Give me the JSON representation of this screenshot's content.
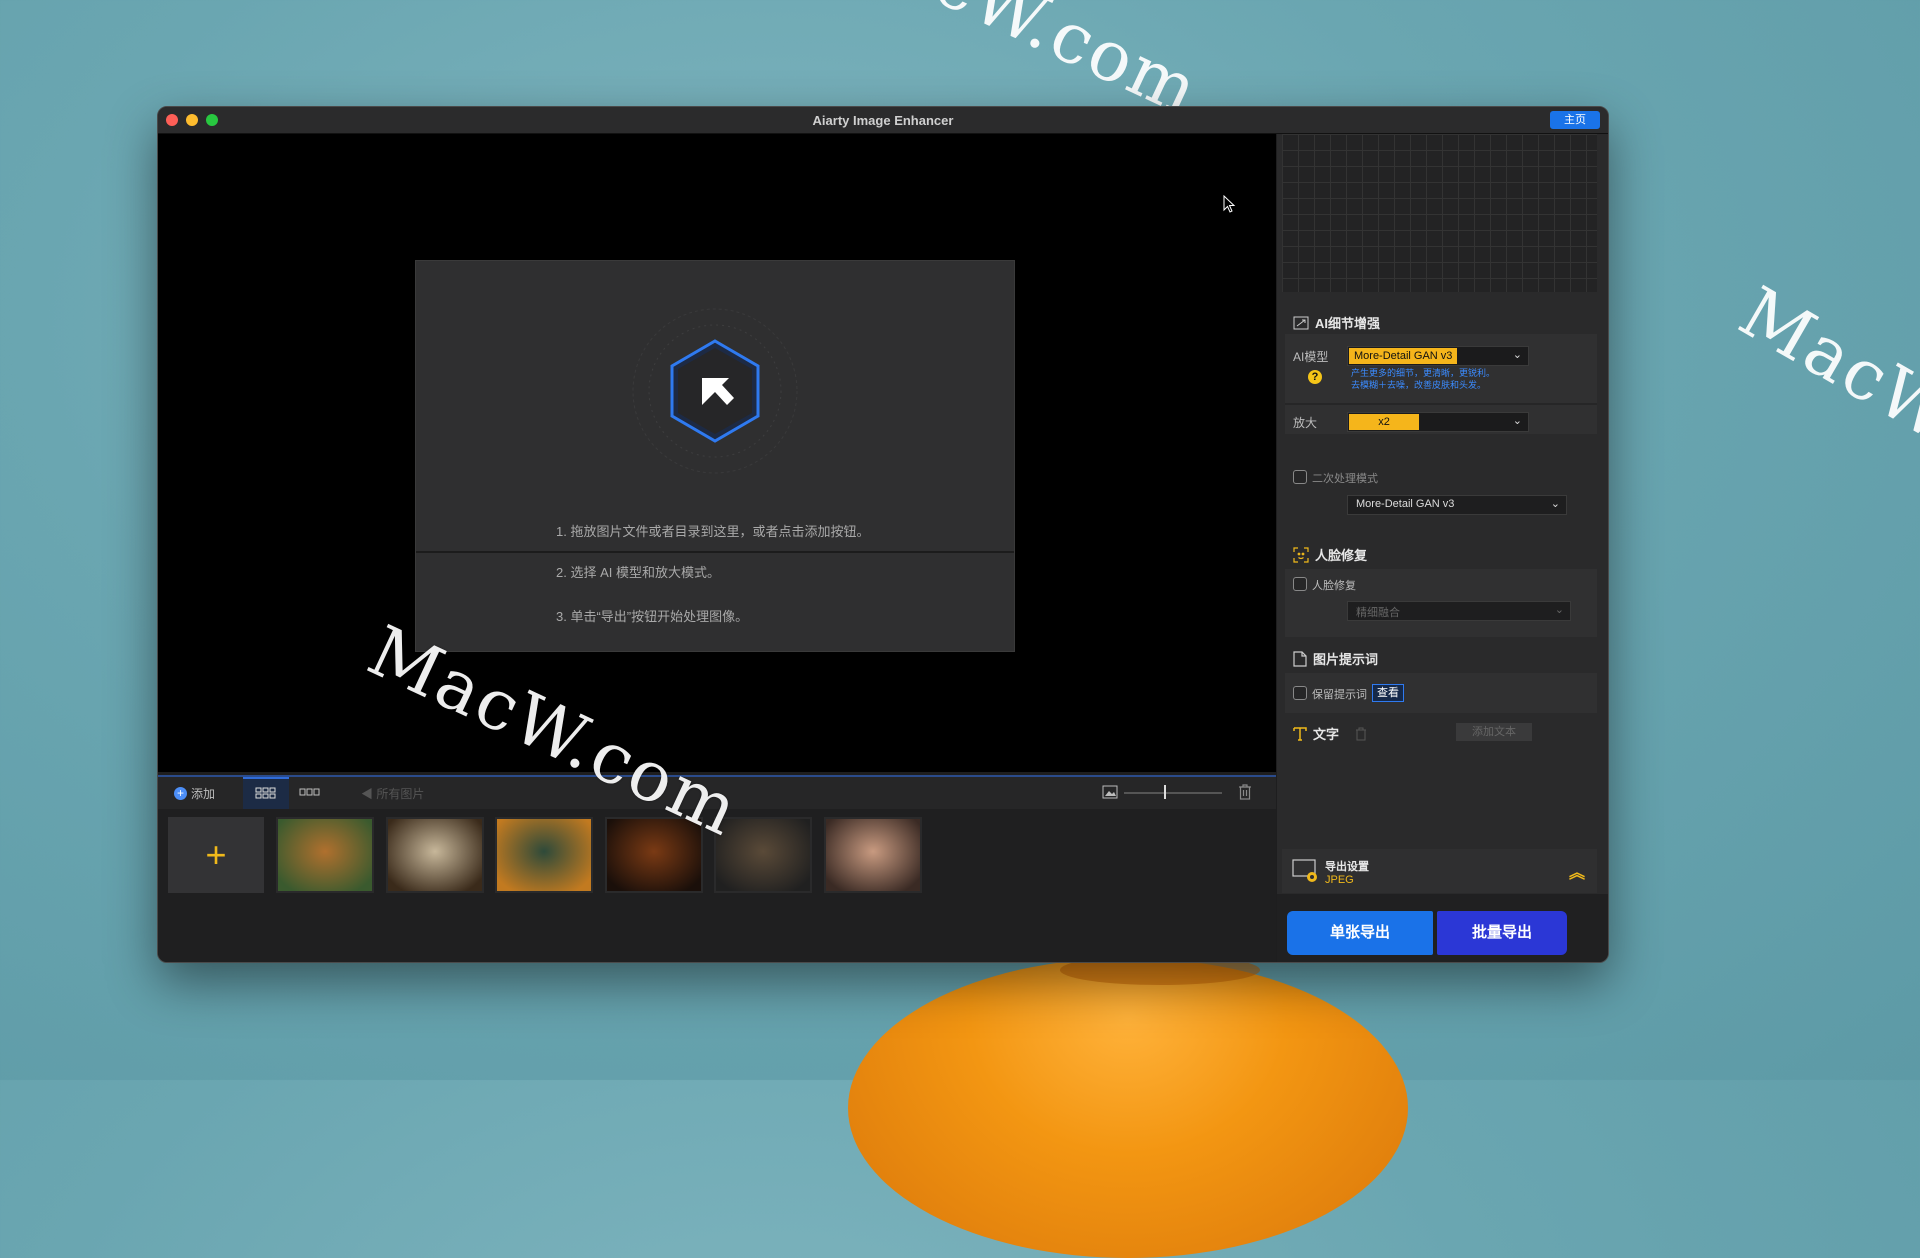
{
  "window": {
    "title": "Aiarty Image Enhancer",
    "home_label": "主页"
  },
  "watermark": "MacW.com",
  "drop_zone": {
    "step1": "1. 拖放图片文件或者目录到这里，或者点击添加按钮。",
    "step2": "2. 选择 AI 模型和放大模式。",
    "step3": "3. 单击“导出”按钮开始处理图像。"
  },
  "toolbar": {
    "add_label": "添加",
    "all_images_label": "所有图片"
  },
  "thumbnails": [
    {
      "name": "tiger",
      "colors": [
        "#b0702e",
        "#3a5a2e"
      ]
    },
    {
      "name": "butterfly",
      "colors": [
        "#c7b79a",
        "#3a2a1a"
      ]
    },
    {
      "name": "bottle-garden",
      "colors": [
        "#2e4a3a",
        "#c27a20"
      ]
    },
    {
      "name": "burger",
      "colors": [
        "#7a3a14",
        "#1a0f0a"
      ]
    },
    {
      "name": "dog-warrior",
      "colors": [
        "#5a4a38",
        "#202020"
      ]
    },
    {
      "name": "portrait",
      "colors": [
        "#c89a80",
        "#3a2a24"
      ]
    }
  ],
  "side": {
    "ai_section_title": "AI细节增强",
    "model_label": "AI模型",
    "model_value": "More-Detail GAN v3",
    "model_desc_line1": "产生更多的细节，更清晰，更锐利。",
    "model_desc_line2": "去模糊＋去噪，改善皮肤和头发。",
    "scale_label": "放大",
    "scale_value": "x2",
    "secondary_label": "二次处理模式",
    "secondary_model": "More-Detail GAN v3",
    "face_section_title": "人脸修复",
    "face_checkbox_label": "人脸修复",
    "face_mode": "精细融合",
    "prompt_section_title": "图片提示词",
    "keep_prompt_label": "保留提示词",
    "view_button": "查看",
    "text_section_title": "文字",
    "add_text_button": "添加文本",
    "export_settings_title": "导出设置",
    "export_format": "JPEG",
    "single_export": "单张导出",
    "batch_export": "批量导出"
  },
  "colors": {
    "accent_blue": "#1a72e8",
    "accent_yellow": "#f5b51b",
    "batch_blue": "#2b37d6"
  }
}
